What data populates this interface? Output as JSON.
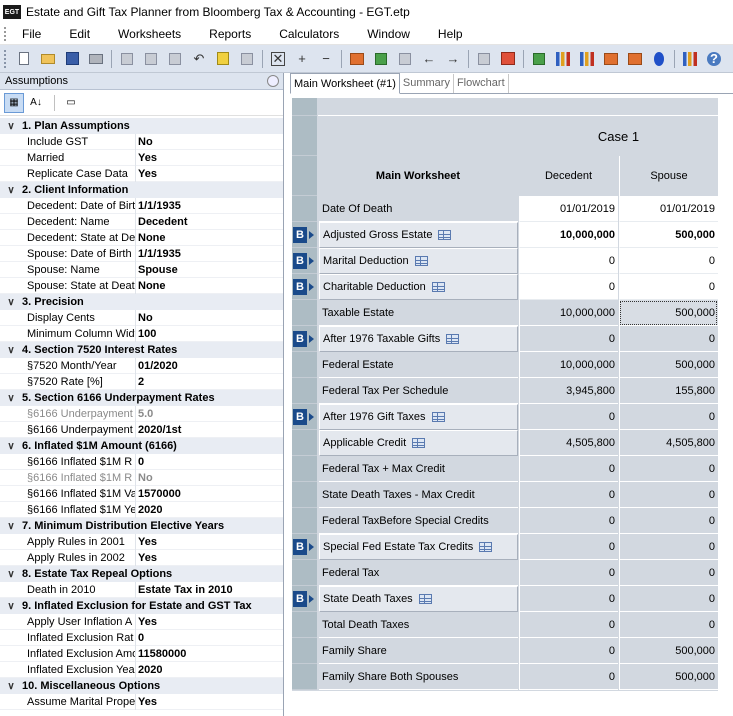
{
  "window": {
    "title": "Estate and Gift Tax Planner from Bloomberg Tax & Accounting - EGT.etp",
    "icon_text": "EGT"
  },
  "menu": [
    "File",
    "Edit",
    "Worksheets",
    "Reports",
    "Calculators",
    "Window",
    "Help"
  ],
  "toolbar_icons": [
    "new-icon",
    "open-icon",
    "save-icon",
    "print-icon",
    "print-preview-icon",
    "copy-icon",
    "paste-icon",
    "undo-icon",
    "edit-icon",
    "calculator-icon",
    "delete-icon",
    "add-icon",
    "remove-icon",
    "chart-icon",
    "refresh-icon",
    "org-chart-icon",
    "back-icon",
    "forward-icon",
    "options-icon",
    "pdf-icon",
    "export-icon",
    "bar-chart-icon",
    "bar-chart-2-icon",
    "tree-icon",
    "house-icon",
    "drop-icon",
    "stats-icon",
    "help-icon"
  ],
  "assumptions": {
    "header": "Assumptions",
    "categories": [
      {
        "title": "1. Plan Assumptions",
        "rows": [
          {
            "name": "Include GST",
            "value": "No"
          },
          {
            "name": "Married",
            "value": "Yes"
          },
          {
            "name": "Replicate Case Data",
            "value": "Yes"
          }
        ]
      },
      {
        "title": "2. Client Information",
        "rows": [
          {
            "name": "Decedent: Date of Birt",
            "value": "1/1/1935"
          },
          {
            "name": "Decedent: Name",
            "value": "Decedent"
          },
          {
            "name": "Decedent: State at De",
            "value": "None"
          },
          {
            "name": "Spouse: Date of Birth",
            "value": "1/1/1935"
          },
          {
            "name": "Spouse: Name",
            "value": "Spouse"
          },
          {
            "name": "Spouse: State at Deat",
            "value": "None"
          }
        ]
      },
      {
        "title": "3. Precision",
        "rows": [
          {
            "name": "Display Cents",
            "value": "No"
          },
          {
            "name": "Minimum Column Widtl",
            "value": "100"
          }
        ]
      },
      {
        "title": "4. Section 7520 Interest Rates",
        "rows": [
          {
            "name": "§7520 Month/Year",
            "value": "01/2020"
          },
          {
            "name": "§7520 Rate [%]",
            "value": "2"
          }
        ]
      },
      {
        "title": "5. Section 6166 Underpayment Rates",
        "rows": [
          {
            "name": "§6166 Underpayment",
            "value": "5.0",
            "disabled": true
          },
          {
            "name": "§6166 Underpayment",
            "value": "2020/1st"
          }
        ]
      },
      {
        "title": "6. Inflated $1M Amount (6166)",
        "rows": [
          {
            "name": "§6166 Inflated $1M R",
            "value": "0"
          },
          {
            "name": "§6166 Inflated $1M R",
            "value": "No",
            "disabled": true
          },
          {
            "name": "§6166 Inflated $1M Va",
            "value": "1570000"
          },
          {
            "name": "§6166 Inflated $1M Ye",
            "value": "2020"
          }
        ]
      },
      {
        "title": "7. Minimum Distribution Elective Years",
        "rows": [
          {
            "name": "Apply Rules in 2001",
            "value": "Yes"
          },
          {
            "name": "Apply Rules in 2002",
            "value": "Yes"
          }
        ]
      },
      {
        "title": "8. Estate Tax Repeal Options",
        "rows": [
          {
            "name": "Death in 2010",
            "value": "Estate Tax in 2010"
          }
        ]
      },
      {
        "title": "9. Inflated Exclusion for Estate and GST Tax",
        "rows": [
          {
            "name": "Apply User Inflation A",
            "value": "Yes"
          },
          {
            "name": "Inflated Exclusion Rat",
            "value": "0"
          },
          {
            "name": "Inflated Exclusion Amo",
            "value": "11580000"
          },
          {
            "name": "Inflated Exclusion Yea",
            "value": "2020"
          }
        ]
      },
      {
        "title": "10. Miscellaneous Options",
        "rows": [
          {
            "name": "Assume Marital Proper",
            "value": "Yes"
          }
        ]
      }
    ]
  },
  "tabs": [
    {
      "label": "Main Worksheet (#1)",
      "active": true
    },
    {
      "label": "Summary",
      "active": false
    },
    {
      "label": "Flowchart",
      "active": false
    }
  ],
  "worksheet": {
    "case_label": "Case 1",
    "title": "Main Worksheet",
    "col1": "Decedent",
    "col2": "Spouse",
    "rows": [
      {
        "label": "Date Of Death",
        "b": false,
        "btn": false,
        "d": "01/01/2019",
        "s": "01/01/2019",
        "style": "white"
      },
      {
        "label": "Adjusted Gross Estate",
        "b": true,
        "btn": true,
        "tbl": true,
        "d": "10,000,000",
        "s": "500,000",
        "style": "white",
        "bold": true
      },
      {
        "label": "Marital Deduction",
        "b": true,
        "btn": true,
        "tbl": true,
        "d": "0",
        "s": "0",
        "style": "white"
      },
      {
        "label": "Charitable Deduction",
        "b": true,
        "btn": true,
        "tbl": true,
        "d": "0",
        "s": "0",
        "style": "white"
      },
      {
        "label": "Taxable Estate",
        "b": false,
        "btn": false,
        "d": "10,000,000",
        "s": "500,000",
        "style": "grey",
        "sel2": true
      },
      {
        "label": "After 1976 Taxable Gifts",
        "b": true,
        "btn": true,
        "tbl": true,
        "d": "0",
        "s": "0",
        "style": "grey"
      },
      {
        "label": "Federal Estate",
        "b": false,
        "btn": false,
        "d": "10,000,000",
        "s": "500,000",
        "style": "grey"
      },
      {
        "label": "Federal Tax Per Schedule",
        "b": false,
        "btn": false,
        "d": "3,945,800",
        "s": "155,800",
        "style": "grey"
      },
      {
        "label": "After 1976 Gift Taxes",
        "b": true,
        "btn": true,
        "tbl": true,
        "d": "0",
        "s": "0",
        "style": "grey"
      },
      {
        "label": "Applicable Credit",
        "b": false,
        "btn": true,
        "tbl": true,
        "d": "4,505,800",
        "s": "4,505,800",
        "style": "grey"
      },
      {
        "label": "Federal Tax + Max Credit",
        "b": false,
        "btn": false,
        "d": "0",
        "s": "0",
        "style": "grey"
      },
      {
        "label": "State Death Taxes - Max Credit",
        "b": false,
        "btn": false,
        "d": "0",
        "s": "0",
        "style": "grey"
      },
      {
        "label": "Federal TaxBefore Special Credits",
        "b": false,
        "btn": false,
        "d": "0",
        "s": "0",
        "style": "grey"
      },
      {
        "label": "Special Fed Estate Tax Credits",
        "b": true,
        "btn": true,
        "tbl": true,
        "d": "0",
        "s": "0",
        "style": "grey"
      },
      {
        "label": "Federal Tax",
        "b": false,
        "btn": false,
        "d": "0",
        "s": "0",
        "style": "grey"
      },
      {
        "label": "State Death Taxes",
        "b": true,
        "btn": true,
        "tbl": true,
        "d": "0",
        "s": "0",
        "style": "grey"
      },
      {
        "label": "Total Death Taxes",
        "b": false,
        "btn": false,
        "d": "0",
        "s": "0",
        "style": "grey"
      },
      {
        "label": "Family Share",
        "b": false,
        "btn": false,
        "d": "0",
        "s": "500,000",
        "style": "grey"
      },
      {
        "label": "Family Share Both Spouses",
        "b": false,
        "btn": false,
        "d": "0",
        "s": "500,000",
        "style": "grey"
      }
    ]
  },
  "colors": {
    "grid_bg": "#d2d8e0",
    "row_header": "#adbcc4",
    "b_icon": "#1a4a8a"
  }
}
